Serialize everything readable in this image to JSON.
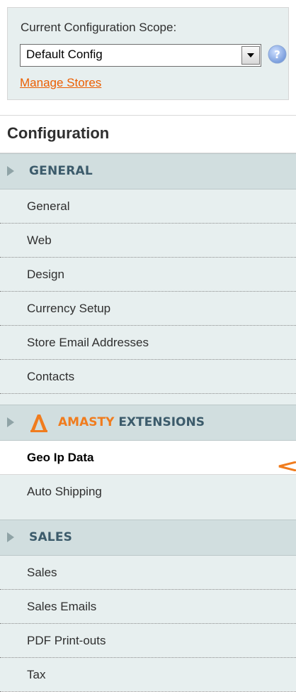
{
  "scope": {
    "label": "Current Configuration Scope:",
    "selected": "Default Config",
    "manage_link": "Manage Stores"
  },
  "config_title": "Configuration",
  "groups": [
    {
      "title": "GENERAL",
      "items": [
        "General",
        "Web",
        "Design",
        "Currency Setup",
        "Store Email Addresses",
        "Contacts"
      ]
    },
    {
      "title_part1": "AMASTY",
      "title_part2": "EXTENSIONS",
      "items": [
        "Geo Ip Data",
        "Auto Shipping"
      ],
      "active_item": "Geo Ip Data"
    },
    {
      "title": "SALES",
      "items": [
        "Sales",
        "Sales Emails",
        "PDF Print-outs",
        "Tax"
      ]
    }
  ],
  "colors": {
    "accent": "#eb5e00",
    "header_bg": "#d1dedf",
    "panel_bg": "#e7efef",
    "group_text": "#3c5b6b"
  },
  "icons": [
    "help-icon",
    "dropdown-arrow-icon",
    "expand-arrow-icon",
    "amasty-logo-icon",
    "pointer-arrow-icon"
  ]
}
